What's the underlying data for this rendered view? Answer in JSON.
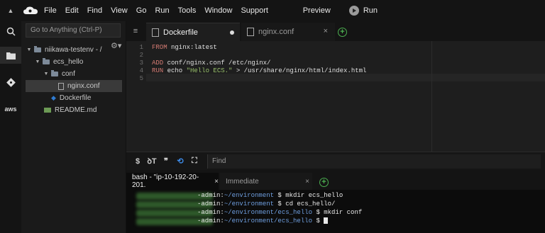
{
  "menubar": {
    "items": [
      "File",
      "Edit",
      "Find",
      "View",
      "Go",
      "Run",
      "Tools",
      "Window",
      "Support"
    ],
    "preview": "Preview",
    "run": "Run"
  },
  "activitybar": {
    "aws_label": "aws"
  },
  "sidebar": {
    "goto_placeholder": "Go to Anything (Ctrl-P)",
    "tree": [
      {
        "label": "niikawa-testenv - /",
        "type": "folder"
      },
      {
        "label": "ecs_hello",
        "type": "folder"
      },
      {
        "label": "conf",
        "type": "folder"
      },
      {
        "label": "nginx.conf",
        "type": "file"
      },
      {
        "label": "Dockerfile",
        "type": "docker"
      },
      {
        "label": "README.md",
        "type": "md"
      }
    ]
  },
  "editor": {
    "tabs": [
      {
        "label": "Dockerfile",
        "active": true
      },
      {
        "label": "nginx.conf",
        "active": false
      }
    ],
    "line_numbers": [
      "1",
      "2",
      "3",
      "4",
      "5"
    ],
    "lines": [
      {
        "kw": "FROM",
        "rest": " nginx:latest",
        "str": "",
        "tail": ""
      },
      {
        "kw": "",
        "rest": "",
        "str": "",
        "tail": ""
      },
      {
        "kw": "ADD",
        "rest": " conf/nginx.conf /etc/nginx/",
        "str": "",
        "tail": ""
      },
      {
        "kw": "RUN",
        "rest": " echo ",
        "str": "\"Hello ECS.\"",
        "tail": " > /usr/share/nginx/html/index.html"
      },
      {
        "kw": "",
        "rest": "",
        "str": "",
        "tail": ""
      }
    ]
  },
  "findbar": {
    "placeholder": "Find"
  },
  "terminal": {
    "tabs": [
      {
        "label": "bash - \"ip-10-192-20-201.",
        "close": "×"
      },
      {
        "label": "Immediate",
        "close": "×"
      }
    ],
    "lines": [
      {
        "prefix": "-admin:",
        "path": "~/environment",
        "cmd": " $ mkdir ecs_hello"
      },
      {
        "prefix": "-admin:",
        "path": "~/environment",
        "cmd": " $ cd ecs_hello/"
      },
      {
        "prefix": "-admin:",
        "path": "~/environment/ecs_hello",
        "cmd": " $ mkdir conf"
      },
      {
        "prefix": "-admin:",
        "path": "~/environment/ecs_hello",
        "cmd": " $ "
      }
    ]
  }
}
